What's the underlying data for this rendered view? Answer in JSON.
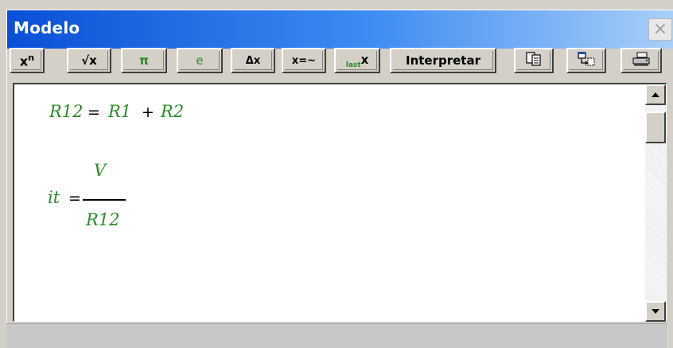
{
  "window": {
    "title": "Modelo",
    "close_symbol": "×"
  },
  "toolbar": {
    "buttons": [
      {
        "label": "x",
        "sup": "n",
        "icon": "power-icon"
      },
      {
        "label": "√x",
        "icon": "sqrt-icon"
      },
      {
        "label": "π",
        "icon": "pi-icon"
      },
      {
        "label": "e",
        "icon": "e-constant-icon"
      },
      {
        "label": "Δx",
        "icon": "delta-icon"
      },
      {
        "label": "x=~",
        "icon": "approx-icon"
      },
      {
        "label": "x",
        "sub": "last",
        "icon": "last-x-icon"
      },
      {
        "label": "Interpretar"
      },
      {
        "icon": "copy-icon"
      },
      {
        "icon": "export-icon"
      },
      {
        "icon": "print-icon"
      }
    ]
  },
  "editor": {
    "eq1": {
      "lhs": "R12",
      "eq": "=",
      "a": "R1",
      "plus": "+",
      "b": "R2"
    },
    "eq2": {
      "lhs": "it",
      "eq": "=",
      "numerator": "V",
      "denominator": "R12"
    }
  },
  "colors": {
    "expression": "#2a8a2a",
    "titlebar_start": "#0a4fd6",
    "titlebar_end": "#a9cff8"
  }
}
